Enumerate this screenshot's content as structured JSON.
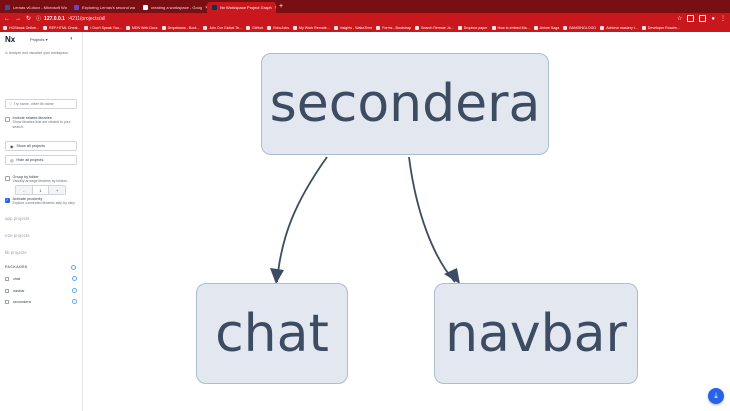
{
  "browser": {
    "tabs": [
      {
        "title": "Lernas v6.docx - Microsoft Wo",
        "color": "#2b579a",
        "active": false
      },
      {
        "title": "Exploring Lernas's second wa",
        "color": "#6b46c1",
        "active": false
      },
      {
        "title": "creating a workspace - Goog",
        "color": "#ffffff",
        "active": false
      },
      {
        "title": "Nx Workspace Project Graph",
        "color": "#143055",
        "active": true
      }
    ],
    "new_tab": "+",
    "url_host": "127.0.0.1",
    "url_path": ":4211/projects/all",
    "bookmarks": [
      "HOSbook Online...",
      "REF:HTML Cheat...",
      "I Don't Speak You...",
      "MDN Web Docs",
      "Dropdowns - Boot...",
      "Join Our Global Te...",
      "GitHub",
      "EchoJobs",
      "My Work Remote...",
      "Insights - WakaTime",
      "Forms - Bootstrap",
      "Search Remote Jo...",
      "Dropbox paper",
      "How to embed Ma...",
      "Anime Saga",
      "BANGINGLOGO",
      "Achieve mastery t...",
      "Developer Roadm..."
    ]
  },
  "sidebar": {
    "logo": "Nx",
    "projects_select": "Projects",
    "description": "Analyze and visualize your workspace.",
    "filter_placeholder": "Try name, other lib name",
    "include_related": {
      "title": "Include related libraries",
      "desc": "Show libraries that are related to your search."
    },
    "show_all": "Show all projects",
    "hide_all": "Hide all projects",
    "group_by_folder": {
      "title": "Group by folder",
      "desc": "Visually arrange libraries by folders."
    },
    "activate_proximity": {
      "title": "Activate proximity",
      "desc": "Explore connected libraries step by step.",
      "checked": true
    },
    "stepper": {
      "minus": "-",
      "value": "1",
      "plus": "+"
    },
    "groups": [
      "app projects",
      "e2e projects",
      "lib projects"
    ],
    "packages_title": "PACKAGES",
    "packages": [
      "chat",
      "navbar",
      "secondera"
    ]
  },
  "graph": {
    "nodes": {
      "secondera": "secondera",
      "chat": "chat",
      "navbar": "navbar"
    },
    "node_fill": "#e3e8f0",
    "node_border": "#aebccf",
    "edge_color": "#3e4c63"
  },
  "download_icon": "download-icon"
}
